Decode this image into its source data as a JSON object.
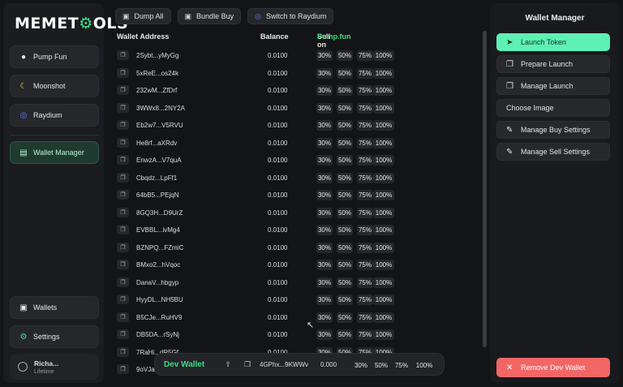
{
  "sidebar": {
    "logo_a": "MEMET",
    "logo_gear": "⚙",
    "logo_b": "OLS",
    "items": [
      {
        "label": "Pump Fun",
        "icon": "pill-icon"
      },
      {
        "label": "Moonshot",
        "icon": "moon-icon"
      },
      {
        "label": "Raydium",
        "icon": "raydium-icon"
      },
      {
        "label": "Wallet Manager",
        "icon": "bar-chart-icon"
      }
    ],
    "bottom": [
      {
        "label": "Wallets",
        "icon": "wallet-icon"
      },
      {
        "label": "Settings",
        "icon": "gear-icon"
      }
    ],
    "user": {
      "name": "Richa...",
      "plan": "Lifetime"
    }
  },
  "toolbar": {
    "dump_all": "Dump All",
    "bundle_buy": "Bundle Buy",
    "switch": "Switch to Raydium"
  },
  "table": {
    "col_address": "Wallet Address",
    "col_balance": "Balance",
    "col_sell_prefix": "Sell on",
    "col_sell_site": "Pump.fun",
    "percents": [
      "30%",
      "50%",
      "75%",
      "100%"
    ],
    "rows": [
      {
        "address": "2Sybt...yMyGg",
        "balance": "0.0100"
      },
      {
        "address": "5xReE...os24k",
        "balance": "0.0100"
      },
      {
        "address": "232wM...ZfDrf",
        "balance": "0.0100"
      },
      {
        "address": "3WWx8...2NY2A",
        "balance": "0.0100"
      },
      {
        "address": "Eb2w7...V5RVU",
        "balance": "0.0100"
      },
      {
        "address": "He8rf...aXRdv",
        "balance": "0.0100"
      },
      {
        "address": "EnwzA...V7quA",
        "balance": "0.0100"
      },
      {
        "address": "Cbqdz...LpFf1",
        "balance": "0.0100"
      },
      {
        "address": "64bB5...PEjqN",
        "balance": "0.0100"
      },
      {
        "address": "8GQ3H...D9UrZ",
        "balance": "0.0100"
      },
      {
        "address": "EVBBL...ivMg4",
        "balance": "0.0100"
      },
      {
        "address": "BZNPQ...FZmiC",
        "balance": "0.0100"
      },
      {
        "address": "BMxo2...hVqoc",
        "balance": "0.0100"
      },
      {
        "address": "DanaV...hbgyp",
        "balance": "0.0100"
      },
      {
        "address": "HyyDL...NH5BU",
        "balance": "0.0100"
      },
      {
        "address": "B5CJe...RuHV9",
        "balance": "0.0100"
      },
      {
        "address": "DB5DA...rSyNj",
        "balance": "0.0100"
      },
      {
        "address": "7RaHi...dR5Gf",
        "balance": "0.0100"
      },
      {
        "address": "9oVJa...",
        "balance": ""
      }
    ]
  },
  "devbar": {
    "label": "Dev Wallet",
    "address": "4GPhx...9KWWv",
    "balance": "0.000",
    "percents": [
      "30%",
      "50%",
      "75%",
      "100%"
    ]
  },
  "panel": {
    "title": "Wallet Manager",
    "buttons": [
      {
        "label": "Launch Token",
        "icon": "rocket-icon"
      },
      {
        "label": "Prepare Launch",
        "icon": "copy-icon"
      },
      {
        "label": "Manage Launch",
        "icon": "copy-icon"
      },
      {
        "label": "Choose Image",
        "icon": ""
      },
      {
        "label": "Manage Buy Settings",
        "icon": "edit-icon"
      },
      {
        "label": "Manage Sell Settings",
        "icon": "edit-icon"
      }
    ],
    "remove": "Remove Dev Wallet"
  }
}
